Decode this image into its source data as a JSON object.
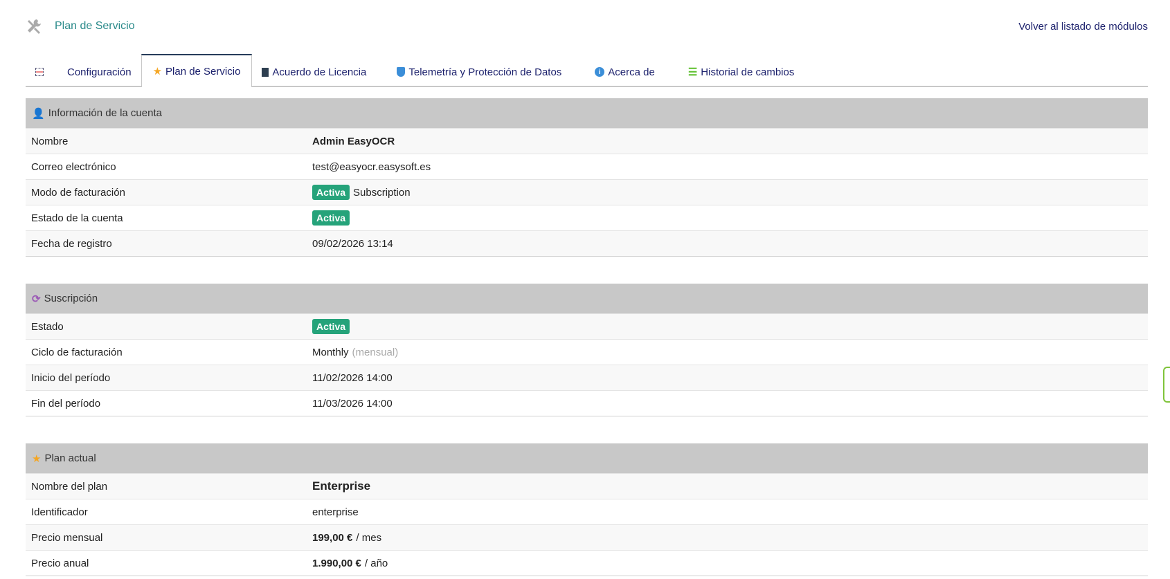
{
  "header": {
    "title": "Plan de Servicio",
    "back_link": "Volver al listado de módulos"
  },
  "tabs": [
    {
      "label": "Configuración"
    },
    {
      "label": "Plan de Servicio"
    },
    {
      "label": "Acuerdo de Licencia"
    },
    {
      "label": "Telemetría y Protección de Datos"
    },
    {
      "label": "Acerca de"
    },
    {
      "label": "Historial de cambios"
    }
  ],
  "account": {
    "title": "Información de la cuenta",
    "name_label": "Nombre",
    "name": "Admin EasyOCR",
    "email_label": "Correo electrónico",
    "email": "test@easyocr.easysoft.es",
    "billing_label": "Modo de facturación",
    "billing_badge": "Activa",
    "billing_mode": "Subscription",
    "status_label": "Estado de la cuenta",
    "status_badge": "Activa",
    "reg_label": "Fecha de registro",
    "reg_date": "09/02/2026 13:14"
  },
  "subscription": {
    "title": "Suscripción",
    "state_label": "Estado",
    "state_badge": "Activa",
    "cycle_label": "Ciclo de facturación",
    "cycle": "Monthly",
    "cycle_note": "(mensual)",
    "start_label": "Inicio del período",
    "start": "11/02/2026 14:00",
    "end_label": "Fin del período",
    "end": "11/03/2026 14:00"
  },
  "plan": {
    "title": "Plan actual",
    "name_label": "Nombre del plan",
    "name": "Enterprise",
    "id_label": "Identificador",
    "id": "enterprise",
    "monthly_label": "Precio mensual",
    "monthly": "199,00 €",
    "monthly_unit": "/ mes",
    "yearly_label": "Precio anual",
    "yearly": "1.990,00 €",
    "yearly_unit": "/ año"
  },
  "colors": {
    "badge": "#25a37a",
    "header_bg": "#c8c8c8",
    "link": "#1a1f6b"
  }
}
